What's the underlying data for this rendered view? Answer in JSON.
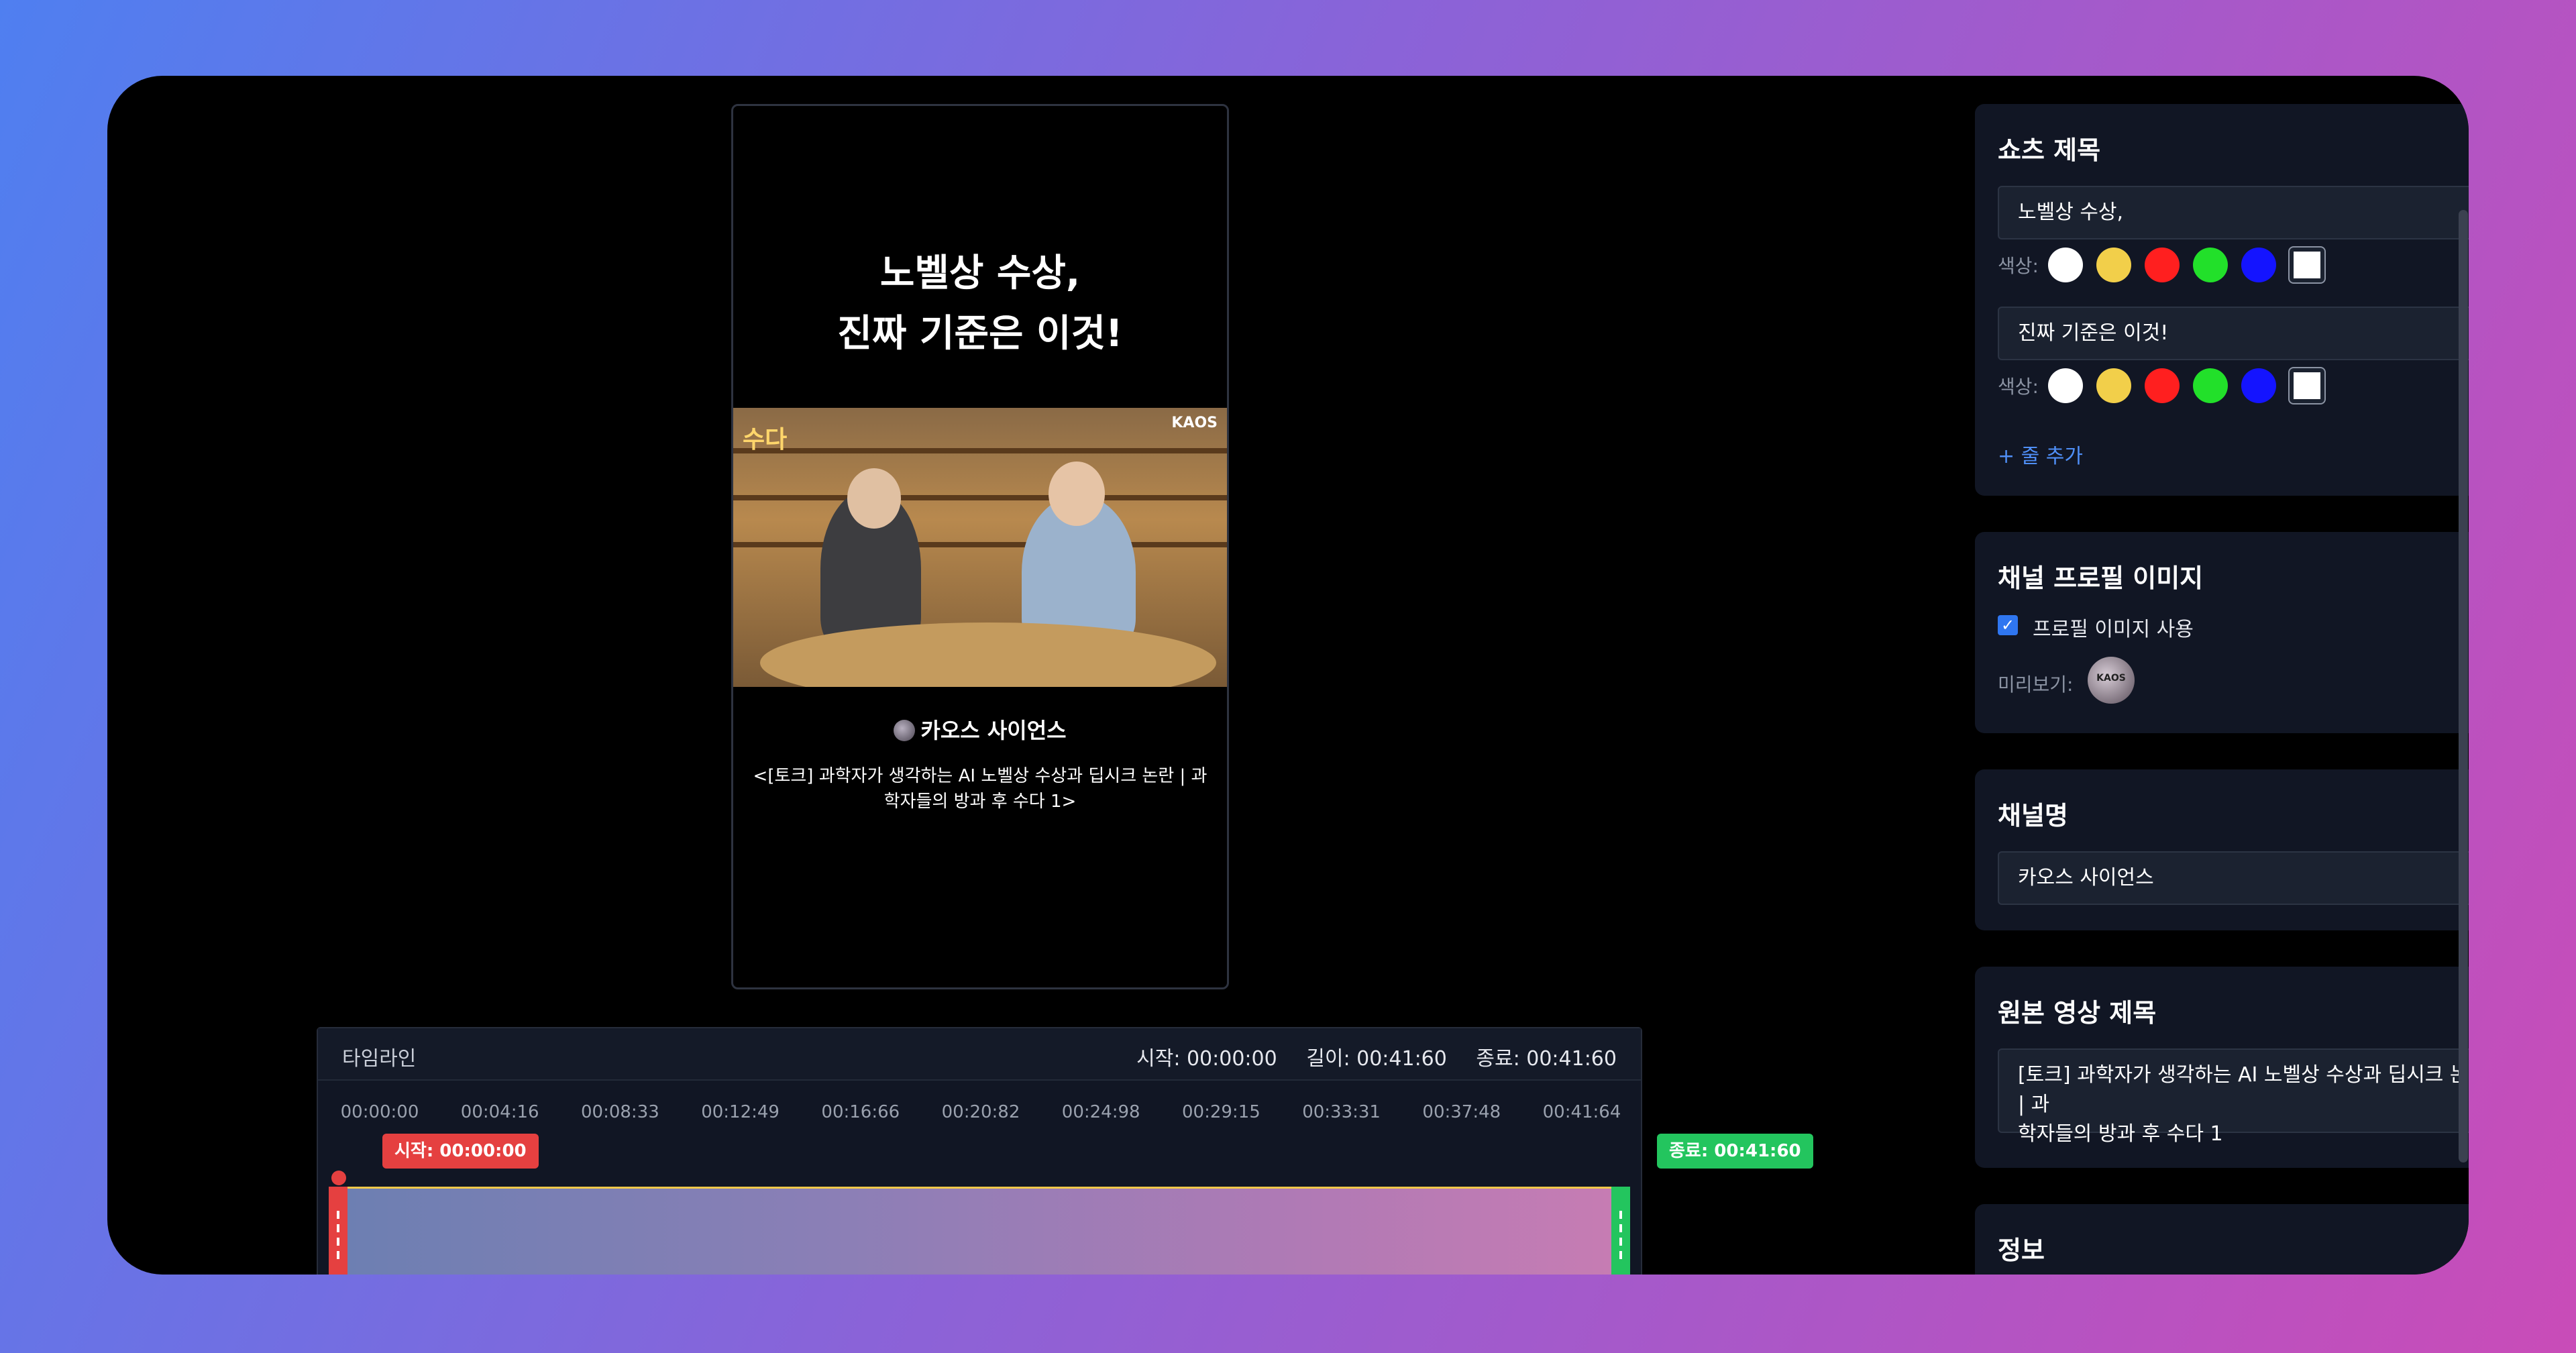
{
  "preview": {
    "title_line1": "노벨상 수상,",
    "title_line2": "진짜 기준은 이것!",
    "thumb_logo_left": "수다",
    "thumb_logo_right": "KAOS",
    "channel_name": "카오스 사이언스",
    "original_title": "<[토크] 과학자가 생각하는 AI 노벨상 수상과 딥시크 논란 | 과학자들의 방과 후 수다 1>"
  },
  "timeline": {
    "label": "타임라인",
    "start": "시작: 00:00:00",
    "length": "길이: 00:41:60",
    "end": "종료: 00:41:60",
    "ticks": [
      "00:00:00",
      "00:04:16",
      "00:08:33",
      "00:12:49",
      "00:16:66",
      "00:20:82",
      "00:24:98",
      "00:29:15",
      "00:33:31",
      "00:37:48",
      "00:41:64"
    ],
    "start_badge": "시작: 00:00:00",
    "end_badge": "종료: 00:41:60"
  },
  "shorts_title_section": {
    "heading": "쇼츠 제목",
    "lines": [
      {
        "text": "노벨상 수상,"
      },
      {
        "text": "진짜 기준은 이것!"
      }
    ],
    "color_label": "색상:",
    "colors": [
      "#ffffff",
      "#f2cf4a",
      "#ff1f1f",
      "#22e02a",
      "#1414ff",
      "#ffffff"
    ],
    "add_line": "+ 줄 추가"
  },
  "profile_section": {
    "heading": "채널 프로필 이미지",
    "checkbox_label": "프로필 이미지 사용",
    "checked": true,
    "preview_label": "미리보기:"
  },
  "channel_section": {
    "heading": "채널명",
    "value": "카오스 사이언스"
  },
  "original_section": {
    "heading": "원본 영상 제목",
    "value_line1": "[토크] 과학자가 생각하는 AI 노벨상 수상과 딥시크 논란 | 과",
    "value_line2": "학자들의 방과 후 수다 1"
  },
  "info_section": {
    "heading": "정보"
  }
}
